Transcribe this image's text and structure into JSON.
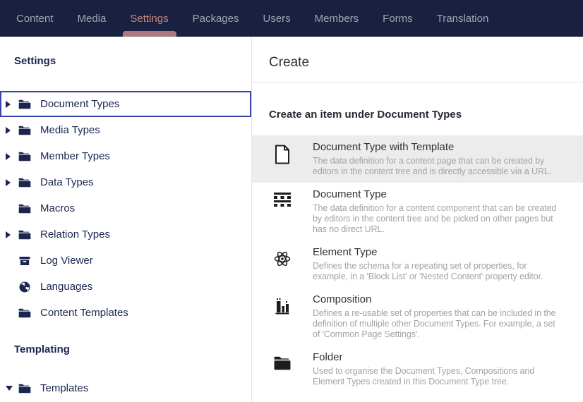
{
  "colors": {
    "nav_bg": "#1a2040",
    "nav_text": "#a2a5b3",
    "nav_active_text": "#c78b7f",
    "nav_active_underline": "#aa7a80",
    "sidebar_text": "#1b264f",
    "selection_border": "#3644a8",
    "divider": "#e4e4e4",
    "highlight_row_bg": "#ececec",
    "panel_title_text": "#303338",
    "description_text": "#a1a3a7"
  },
  "top_nav": {
    "items": [
      {
        "label": "Content",
        "active": false
      },
      {
        "label": "Media",
        "active": false
      },
      {
        "label": "Settings",
        "active": true
      },
      {
        "label": "Packages",
        "active": false
      },
      {
        "label": "Users",
        "active": false
      },
      {
        "label": "Members",
        "active": false
      },
      {
        "label": "Forms",
        "active": false
      },
      {
        "label": "Translation",
        "active": false
      }
    ]
  },
  "sidebar": {
    "section_title": "Settings",
    "tree": [
      {
        "label": "Document Types",
        "icon": "folder-icon",
        "caret": "right",
        "selected": true
      },
      {
        "label": "Media Types",
        "icon": "folder-icon",
        "caret": "right",
        "selected": false
      },
      {
        "label": "Member Types",
        "icon": "folder-icon",
        "caret": "right",
        "selected": false
      },
      {
        "label": "Data Types",
        "icon": "folder-icon",
        "caret": "right",
        "selected": false
      },
      {
        "label": "Macros",
        "icon": "folder-icon",
        "caret": "none",
        "selected": false
      },
      {
        "label": "Relation Types",
        "icon": "folder-icon",
        "caret": "right",
        "selected": false
      },
      {
        "label": "Log Viewer",
        "icon": "box-icon",
        "caret": "none",
        "selected": false
      },
      {
        "label": "Languages",
        "icon": "globe-icon",
        "caret": "none",
        "selected": false
      },
      {
        "label": "Content Templates",
        "icon": "folder-icon",
        "caret": "none",
        "selected": false
      }
    ],
    "section2_title": "Templating",
    "tree2": [
      {
        "label": "Templates",
        "icon": "folder-icon",
        "caret": "down",
        "selected": false
      }
    ]
  },
  "panel": {
    "title": "Create",
    "subtitle": "Create an item under Document Types",
    "items": [
      {
        "title": "Document Type with Template",
        "icon": "document-icon",
        "highlighted": true,
        "description": "The data definition for a content page that can be created by editors in the content tree and is directly accessible via a URL."
      },
      {
        "title": "Document Type",
        "icon": "item-arrangement-icon",
        "highlighted": false,
        "description": "The data definition for a content component that can be created by editors in the content tree and be picked on other pages but has no direct URL."
      },
      {
        "title": "Element Type",
        "icon": "atom-icon",
        "highlighted": false,
        "description": "Defines the schema for a repeating set of properties, for example, in a 'Block List' or 'Nested Content' property editor."
      },
      {
        "title": "Composition",
        "icon": "buildings-icon",
        "highlighted": false,
        "description": "Defines a re-usable set of properties that can be included in the definition of multiple other Document Types. For example, a set of 'Common Page Settings'."
      },
      {
        "title": "Folder",
        "icon": "folder-black-icon",
        "highlighted": false,
        "description": "Used to organise the Document Types, Compositions and Element Types created in this Document Type tree."
      }
    ]
  }
}
